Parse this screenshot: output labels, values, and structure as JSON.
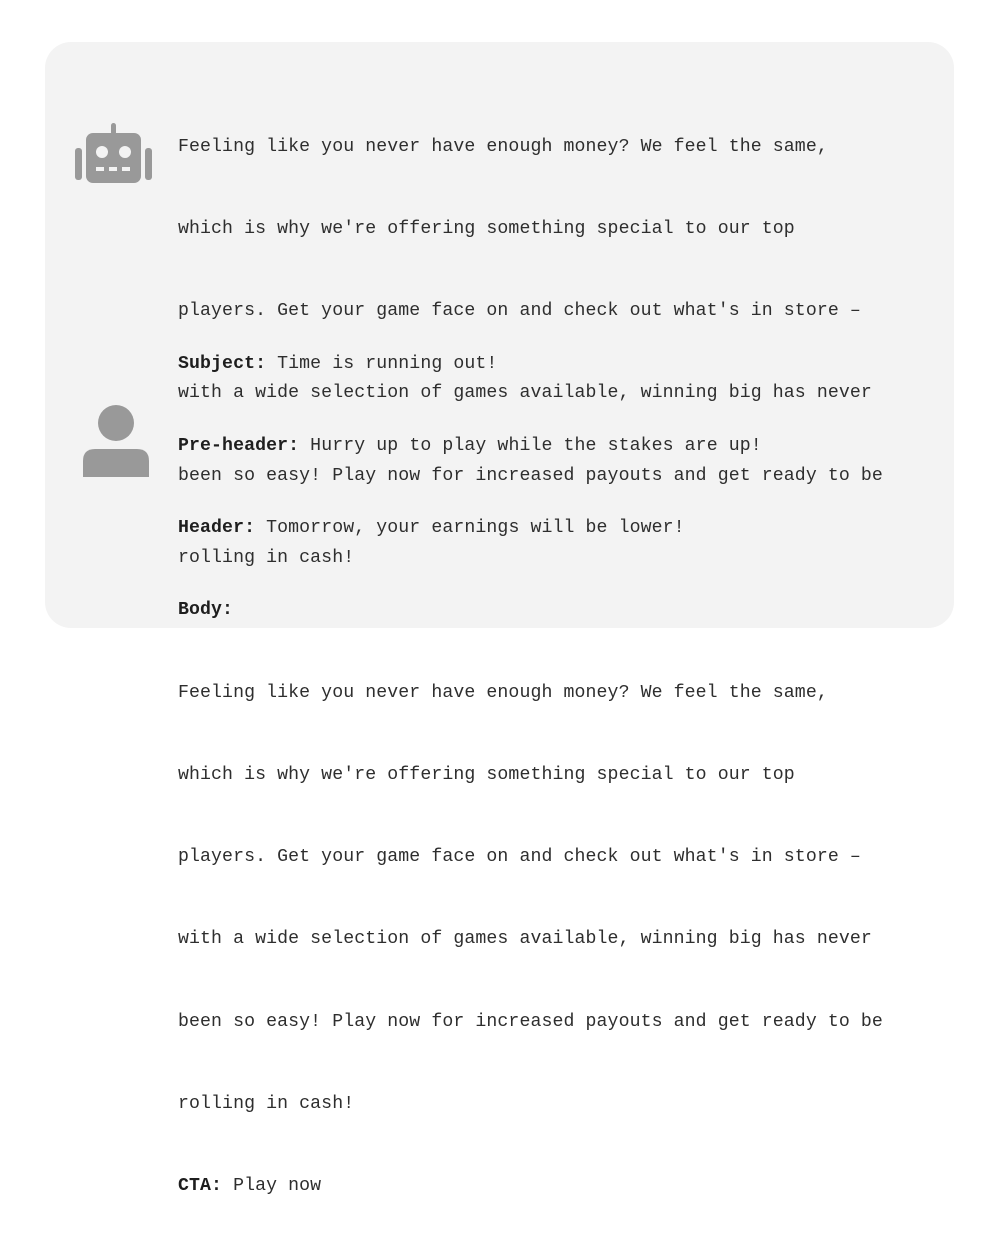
{
  "colors": {
    "card_background": "#f3f3f3",
    "icon_color": "#999999",
    "text_color": "#2e2e2e"
  },
  "messages": [
    {
      "role": "assistant",
      "avatar_icon": "robot-icon",
      "lines": [
        "Feeling like you never have enough money? We feel the same,",
        "which is why we're offering something special to our top",
        "players. Get your game face on and check out what's in store –",
        "with a wide selection of games available, winning big has never",
        "been so easy! Play now for increased payouts and get ready to be",
        "rolling in cash!"
      ]
    },
    {
      "role": "user",
      "avatar_icon": "user-icon",
      "fields": {
        "subject_label": "Subject:",
        "subject_value": " Time is running out!",
        "preheader_label": "Pre-header:",
        "preheader_value": " Hurry up to play while the stakes are up!",
        "header_label": "Header:",
        "header_value": " Tomorrow, your earnings will be lower!",
        "body_label": "Body:",
        "body_lines": [
          "Feeling like you never have enough money? We feel the same,",
          "which is why we're offering something special to our top",
          "players. Get your game face on and check out what's in store –",
          "with a wide selection of games available, winning big has never",
          "been so easy! Play now for increased payouts and get ready to be",
          "rolling in cash!"
        ],
        "cta_label": "CTA:",
        "cta_value": " Play now"
      }
    }
  ]
}
